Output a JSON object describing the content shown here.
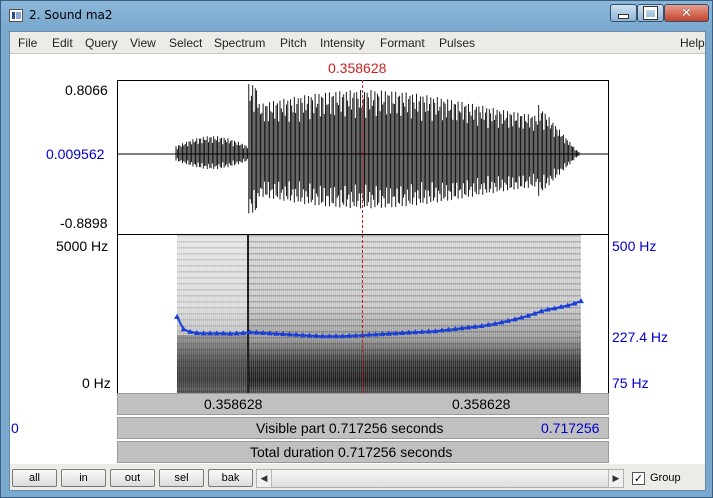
{
  "window": {
    "title": "2. Sound ma2",
    "close_glyph": "✕"
  },
  "menu": [
    "File",
    "Edit",
    "Query",
    "View",
    "Select",
    "Spectrum",
    "Pitch",
    "Intensity",
    "Formant",
    "Pulses",
    "Help"
  ],
  "cursor": {
    "time": "0.358628",
    "fraction": 0.5
  },
  "waveform": {
    "max_label": "0.8066",
    "zero_label": "0.009562",
    "min_label": "-0.8898"
  },
  "spectrogram": {
    "freq_max_label": "5000 Hz",
    "freq_min_label": "0 Hz",
    "pitch_max_label": "500 Hz",
    "pitch_mid_label": "227.4 Hz",
    "pitch_min_label": "75 Hz",
    "pitch_color": "#1a3fd6"
  },
  "pitch_contour": {
    "units": "Hz",
    "range": [
      75,
      500
    ],
    "values": [
      277,
      243,
      236,
      233,
      232,
      232,
      232,
      232,
      231,
      232,
      233,
      235,
      234,
      233,
      232,
      231,
      230,
      229,
      228,
      227,
      226,
      225,
      224,
      224,
      224,
      224,
      225,
      226,
      227,
      228,
      229,
      230,
      231,
      232,
      233,
      234,
      235,
      236,
      237,
      238,
      240,
      242,
      244,
      246,
      248,
      250,
      252,
      255,
      258,
      262,
      266,
      270,
      275,
      280,
      286,
      292,
      297,
      300,
      304,
      308,
      313,
      320
    ]
  },
  "selection_row": {
    "left_time": "0.358628",
    "right_time": "0.358628"
  },
  "visible_row": {
    "start": "0",
    "label": "Visible part 0.717256 seconds",
    "end": "0.717256"
  },
  "total_row": {
    "label": "Total duration 0.717256 seconds"
  },
  "bottom_buttons": [
    "all",
    "in",
    "out",
    "sel",
    "bak"
  ],
  "scroll": {
    "left_arrow": "◀",
    "right_arrow": "▶"
  },
  "group": {
    "label": "Group",
    "checked": true,
    "check_glyph": "✓"
  }
}
